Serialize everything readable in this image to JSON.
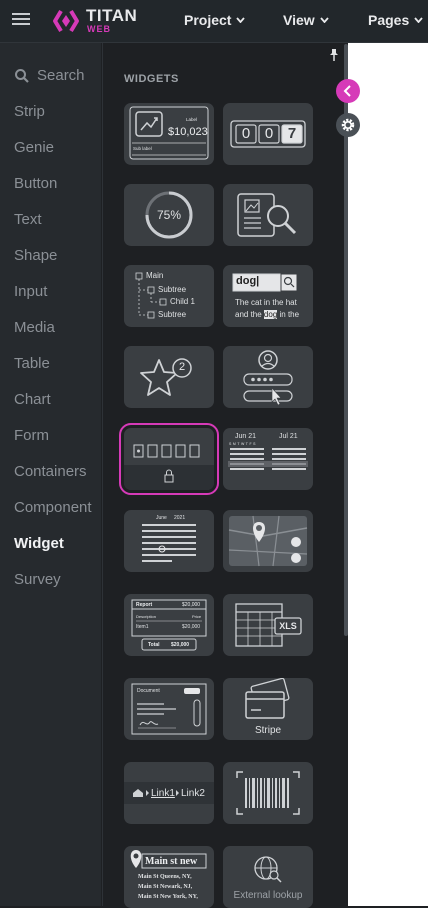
{
  "header": {
    "logo_title": "TITAN",
    "logo_subtitle": "WEB",
    "menus": [
      {
        "label": "Project"
      },
      {
        "label": "View"
      },
      {
        "label": "Pages"
      }
    ]
  },
  "sidebar": {
    "search_placeholder": "Search",
    "items": [
      {
        "label": "Strip"
      },
      {
        "label": "Genie"
      },
      {
        "label": "Button"
      },
      {
        "label": "Text"
      },
      {
        "label": "Shape"
      },
      {
        "label": "Input"
      },
      {
        "label": "Media"
      },
      {
        "label": "Table"
      },
      {
        "label": "Chart"
      },
      {
        "label": "Form"
      },
      {
        "label": "Containers"
      },
      {
        "label": "Component"
      },
      {
        "label": "Widget",
        "active": true
      },
      {
        "label": "Survey"
      }
    ]
  },
  "panel": {
    "title": "WIDGETS",
    "tiles": {
      "kpi": {
        "value": "$10,023",
        "label": "Label",
        "sublabel": "Sub label"
      },
      "counter": {
        "digits": [
          "0",
          "0",
          "7"
        ]
      },
      "progress": {
        "value": "75%"
      },
      "tree": {
        "main": "Main",
        "subtree": "Subtree",
        "child": "Child 1",
        "subtree2": "Subtree"
      },
      "text_search": {
        "query": "dog|",
        "line1": "The cat in the hat",
        "line2_pre": "and the ",
        "line2_hl": "dog",
        "line2_post": " in the"
      },
      "rating": {
        "count": "2"
      },
      "datepicker_double": {
        "month1": "Jun 21",
        "month2": "Jul 21",
        "weekdays": "S M T W T F S"
      },
      "calendar": {
        "month": "June",
        "year": "2021"
      },
      "invoice": {
        "title": "Report",
        "amount": "$20,000",
        "desc": "Description",
        "price": "Price",
        "item": "Item1",
        "item_amount": "$20,000",
        "total_label": "Total",
        "total": "$20,000"
      },
      "excel": {
        "badge": "XLS"
      },
      "document": {
        "title": "Document"
      },
      "stripe": {
        "label": "Stripe"
      },
      "breadcrumb": {
        "link1": "Link1",
        "link2": "Link2"
      },
      "address": {
        "input": "Main st new",
        "line1": "Main St Queens, NY,",
        "line2": "Main St Newark, NJ,",
        "line3": "Main St New York, NY,"
      },
      "external_lookup": {
        "label": "External lookup"
      }
    }
  },
  "colors": {
    "accent": "#d63ab8",
    "sidebar_bg": "#262a2e",
    "panel_bg": "#1e2023",
    "tile_bg": "#3a3e42"
  }
}
